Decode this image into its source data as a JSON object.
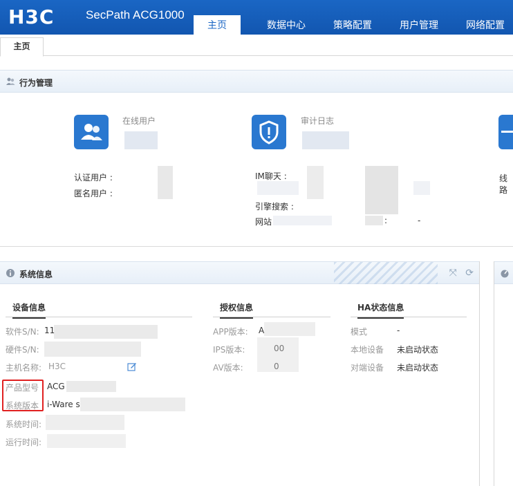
{
  "header": {
    "logo": "H3C",
    "product": "SecPath ACG1000",
    "nav": [
      {
        "label": "主页",
        "active": true
      },
      {
        "label": "数据中心",
        "active": false
      },
      {
        "label": "策略配置",
        "active": false
      },
      {
        "label": "用户管理",
        "active": false
      },
      {
        "label": "网络配置",
        "active": false
      }
    ]
  },
  "page_tab": "主页",
  "behavior": {
    "title": "行为管理",
    "online_users": {
      "label": "在线用户",
      "icon": "users-icon"
    },
    "audit_log": {
      "label": "审计日志",
      "icon": "shield-icon"
    },
    "fields": {
      "auth_user": "认证用户 :",
      "anon_user": "匿名用户 :",
      "im_chat": "IM聊天 :",
      "engine_search": "引擎搜索 :",
      "website": "网站",
      "line": "线路",
      "dash": "-"
    }
  },
  "system_info": {
    "title": "系统信息",
    "device": {
      "title": "设备信息",
      "software_sn": {
        "label": "软件S/N:",
        "value": "11"
      },
      "hardware_sn": {
        "label": "硬件S/N:",
        "value": ""
      },
      "hostname": {
        "label": "主机名称:",
        "value": "H3C"
      },
      "model": {
        "label": "产品型号",
        "value": "ACG"
      },
      "version": {
        "label": "系统版本",
        "value": "i-Ware s"
      },
      "system_time": {
        "label": "系统时间:",
        "value": ""
      },
      "uptime": {
        "label": "运行时间:",
        "value": ""
      }
    },
    "license": {
      "title": "授权信息",
      "app": {
        "label": "APP版本:",
        "value": "A"
      },
      "ips": {
        "label": "IPS版本:",
        "value": "00"
      },
      "av": {
        "label": "AV版本:",
        "value": "0"
      }
    },
    "ha": {
      "title": "HA状态信息",
      "mode": {
        "label": "模式",
        "value": "-"
      },
      "local": {
        "label": "本地设备",
        "value": "未启动状态"
      },
      "peer": {
        "label": "对端设备",
        "value": "未启动状态"
      }
    }
  },
  "colors": {
    "header_blue": "#1a66c4",
    "icon_blue": "#2a78d0",
    "highlight_red": "#e02020"
  }
}
